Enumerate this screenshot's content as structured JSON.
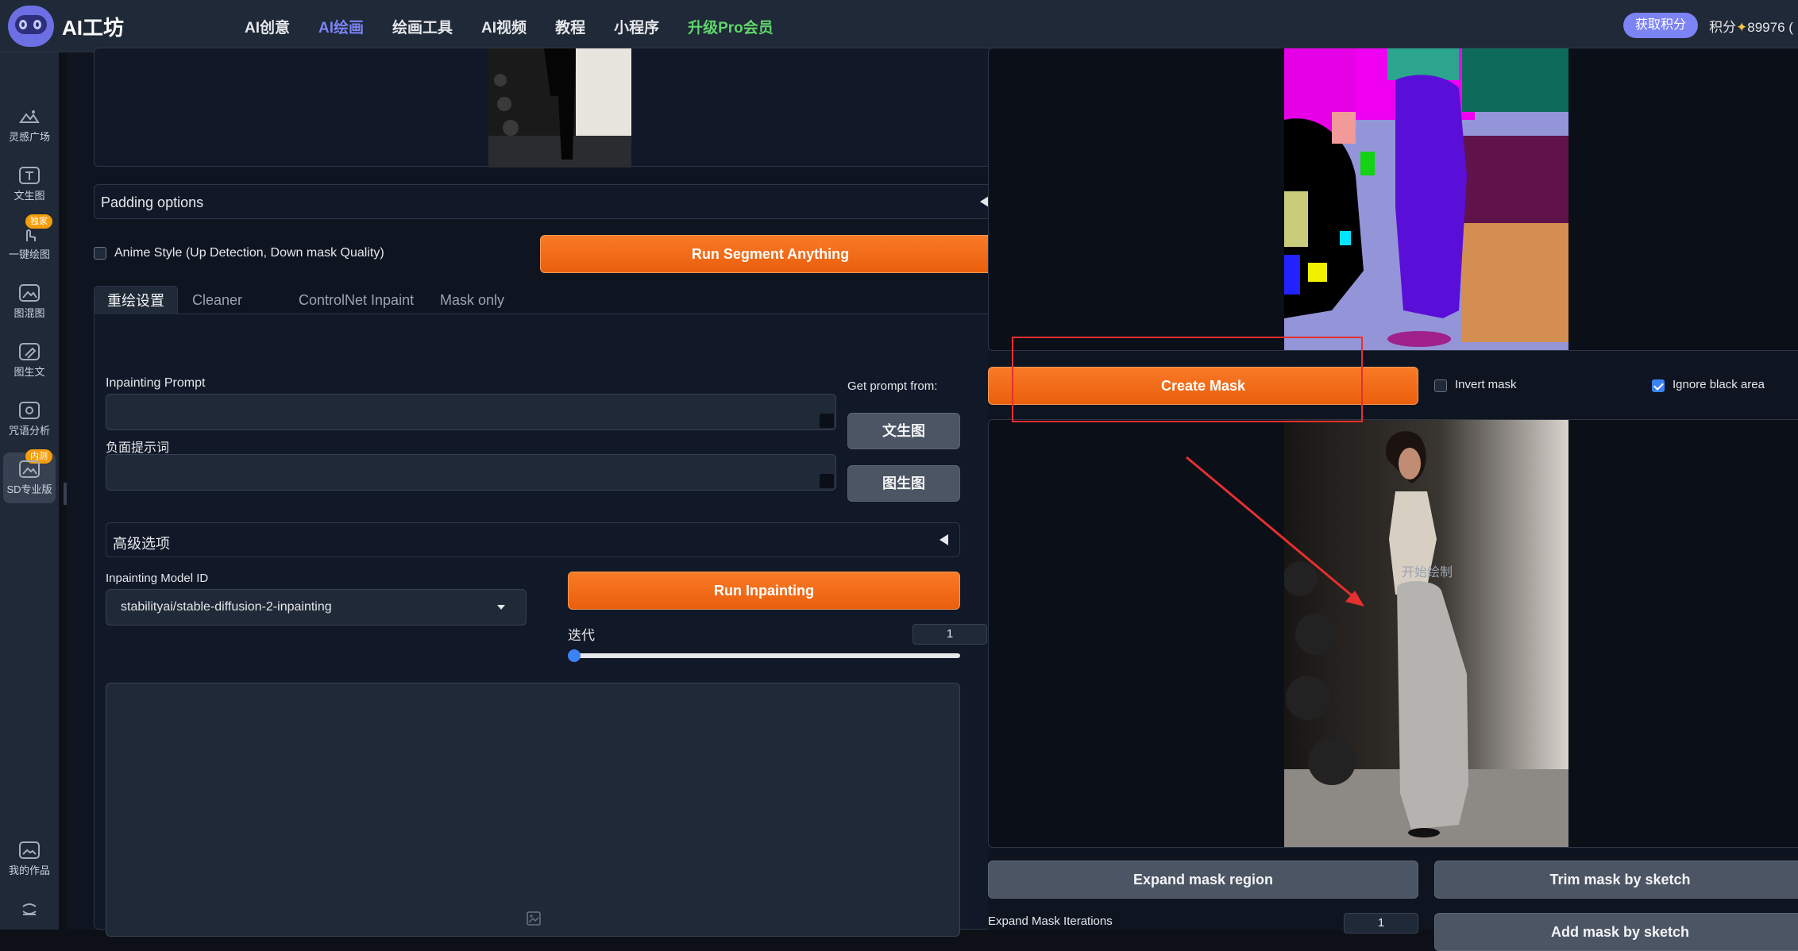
{
  "topbar": {
    "logo_text": "AI工坊",
    "nav": [
      "AI创意",
      "AI绘画",
      "绘画工具",
      "AI视频",
      "教程",
      "小程序",
      "升级Pro会员"
    ],
    "points_button": "获取积分",
    "points_label": "积分",
    "points_value": "89976",
    "trailing": "("
  },
  "sidebar": {
    "items": [
      {
        "label": "灵感广场",
        "icon": "mountain-icon"
      },
      {
        "label": "文生图",
        "icon": "text-icon"
      },
      {
        "label": "一键绘图",
        "icon": "hand-pointer-icon",
        "tag": "独家"
      },
      {
        "label": "图混图",
        "icon": "image-mix-icon"
      },
      {
        "label": "图生文",
        "icon": "image-edit-icon"
      },
      {
        "label": "咒语分析",
        "icon": "analysis-icon"
      },
      {
        "label": "SD专业版",
        "icon": "sd-icon",
        "tag": "内测"
      },
      {
        "label": "我的作品",
        "icon": "gallery-icon"
      },
      {
        "label": "",
        "icon": "settings-icon"
      }
    ],
    "collapse_glyph": "›"
  },
  "left": {
    "padding_options": "Padding options",
    "anime_style": "Anime Style (Up Detection, Down mask Quality)",
    "run_segment": "Run Segment Anything",
    "tabs": [
      "重绘设置",
      "Cleaner",
      "ControlNet Inpaint",
      "Mask only"
    ],
    "inpainting_prompt_label": "Inpainting Prompt",
    "negative_prompt_label": "负面提示词",
    "get_prompt_from": "Get prompt from:",
    "btn_txt2img": "文生图",
    "btn_img2img": "图生图",
    "advanced_options": "高级选项",
    "model_id_label": "Inpainting Model ID",
    "model_id_value": "stabilityai/stable-diffusion-2-inpainting",
    "run_inpainting": "Run Inpainting",
    "iterations_label": "迭代",
    "iterations_value": "1",
    "iterations_fraction": 0.0
  },
  "right": {
    "create_mask": "Create Mask",
    "invert_mask": "Invert mask",
    "invert_mask_checked": false,
    "ignore_black": "Ignore black area",
    "ignore_black_checked": true,
    "sketch_hint": "开始绘制",
    "expand_mask_region": "Expand mask region",
    "trim_mask_by_sketch": "Trim mask by sketch",
    "expand_mask_iterations": "Expand Mask Iterations",
    "expand_iterations_value": "1",
    "add_mask_by_sketch": "Add mask by sketch"
  },
  "colors": {
    "accent_orange": "#ea5f0c",
    "accent_purple": "#7c83f4",
    "pro_green": "#5fd66b",
    "annotation_red": "#e53030"
  }
}
